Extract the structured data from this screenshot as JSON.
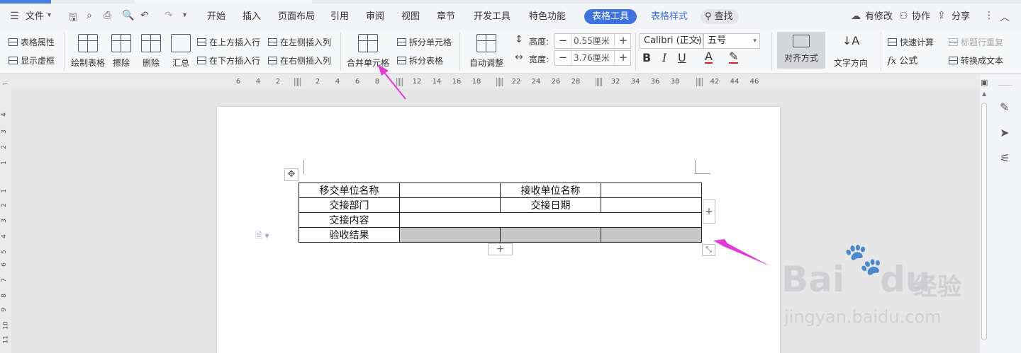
{
  "menubar": {
    "file": "文件",
    "tabs": [
      "开始",
      "插入",
      "页面布局",
      "引用",
      "审阅",
      "视图",
      "章节",
      "开发工具",
      "特色功能"
    ],
    "active_tab": "表格工具",
    "style_tab": "表格样式",
    "search": "查找",
    "modified": "有修改",
    "collab": "协作",
    "share": "分享"
  },
  "ribbon": {
    "table_props": "表格属性",
    "show_grid": "显示虚框",
    "draw_table": "绘制表格",
    "erase": "擦除",
    "delete": "删除",
    "summary": "汇总",
    "insert_above": "在上方插入行",
    "insert_below": "在下方插入行",
    "insert_left": "在左侧插入列",
    "insert_right": "在右侧插入列",
    "merge_cells": "合并单元格",
    "split_cells": "拆分单元格",
    "split_table": "拆分表格",
    "auto_adjust": "自动调整",
    "height_label": "高度:",
    "height_value": "0.55厘米",
    "width_label": "宽度:",
    "width_value": "3.76厘米",
    "font_name": "Calibri (正文)",
    "font_size": "五号",
    "align": "对齐方式",
    "text_dir": "文字方向",
    "quick_calc": "快速计算",
    "header_repeat": "标题行重复",
    "formula": "公式",
    "to_text": "转换成文本"
  },
  "ruler": {
    "ticks": [
      "6",
      "4",
      "2",
      "2",
      "4",
      "6",
      "8",
      "12",
      "14",
      "16",
      "18",
      "22",
      "24",
      "26",
      "28",
      "32",
      "34",
      "36",
      "38",
      "42",
      "44",
      "46"
    ]
  },
  "vruler": {
    "ticks": [
      "4",
      "3",
      "2",
      "1",
      "1",
      "2",
      "3",
      "4",
      "5",
      "6",
      "7",
      "8",
      "9",
      "10",
      "11"
    ]
  },
  "table": {
    "rows": [
      [
        "移交单位名称",
        "",
        "接收单位名称",
        ""
      ],
      [
        "交接部门",
        "",
        "交接日期",
        ""
      ],
      [
        "交接内容",
        "",
        "",
        ""
      ],
      [
        "验收结果",
        "",
        "",
        ""
      ]
    ]
  },
  "watermark": {
    "brand": "Bai",
    "brand2": "du",
    "cn": "经验",
    "url": "jingyan.baidu.com"
  },
  "colors": {
    "accent": "#3d72e0",
    "arrow": "#e33ad6",
    "selected_cell": "#c8c8c8"
  }
}
